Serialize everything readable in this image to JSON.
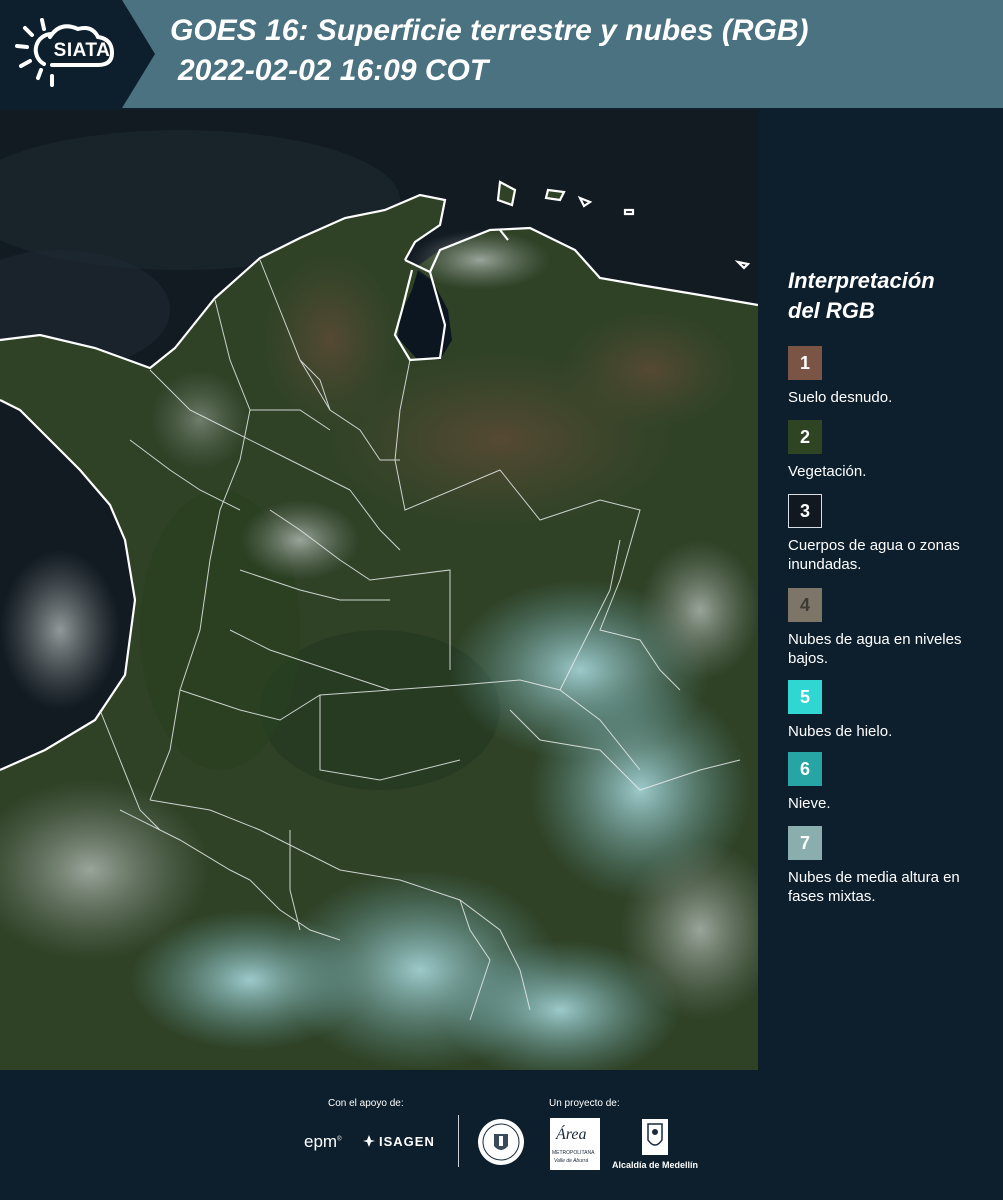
{
  "header": {
    "logo_text": "SIATA",
    "title_line1": "GOES 16: Superficie terrestre y nubes (RGB)",
    "title_line2": "2022-02-02 16:09 COT"
  },
  "legend": {
    "title_line1": "Interpretación",
    "title_line2": "del RGB",
    "items": [
      {
        "number": "1",
        "label": "Suelo desnudo.",
        "color": "#7a5444"
      },
      {
        "number": "2",
        "label": "Vegetación.",
        "color": "#2e4423"
      },
      {
        "number": "3",
        "label": "Cuerpos de agua o zonas inundadas.",
        "color": "#111820"
      },
      {
        "number": "4",
        "label": "Nubes de agua en niveles bajos.",
        "color": "#7d7568"
      },
      {
        "number": "5",
        "label": "Nubes de hielo.",
        "color": "#2fd6d2"
      },
      {
        "number": "6",
        "label": "Nieve.",
        "color": "#27a5a4"
      },
      {
        "number": "7",
        "label": "Nubes de media altura en fases mixtas.",
        "color": "#8aaeae"
      }
    ]
  },
  "footer": {
    "support_label": "Con el apoyo de:",
    "project_label": "Un proyecto de:",
    "sponsors": {
      "epm": "epm",
      "isagen": "ISAGEN"
    },
    "partners": {
      "metro_name": "Área",
      "metro_sub1": "METROPOLITANA",
      "metro_sub2": "Valle de Aburrá",
      "alcaldia": "Alcaldía de Medellín"
    }
  }
}
